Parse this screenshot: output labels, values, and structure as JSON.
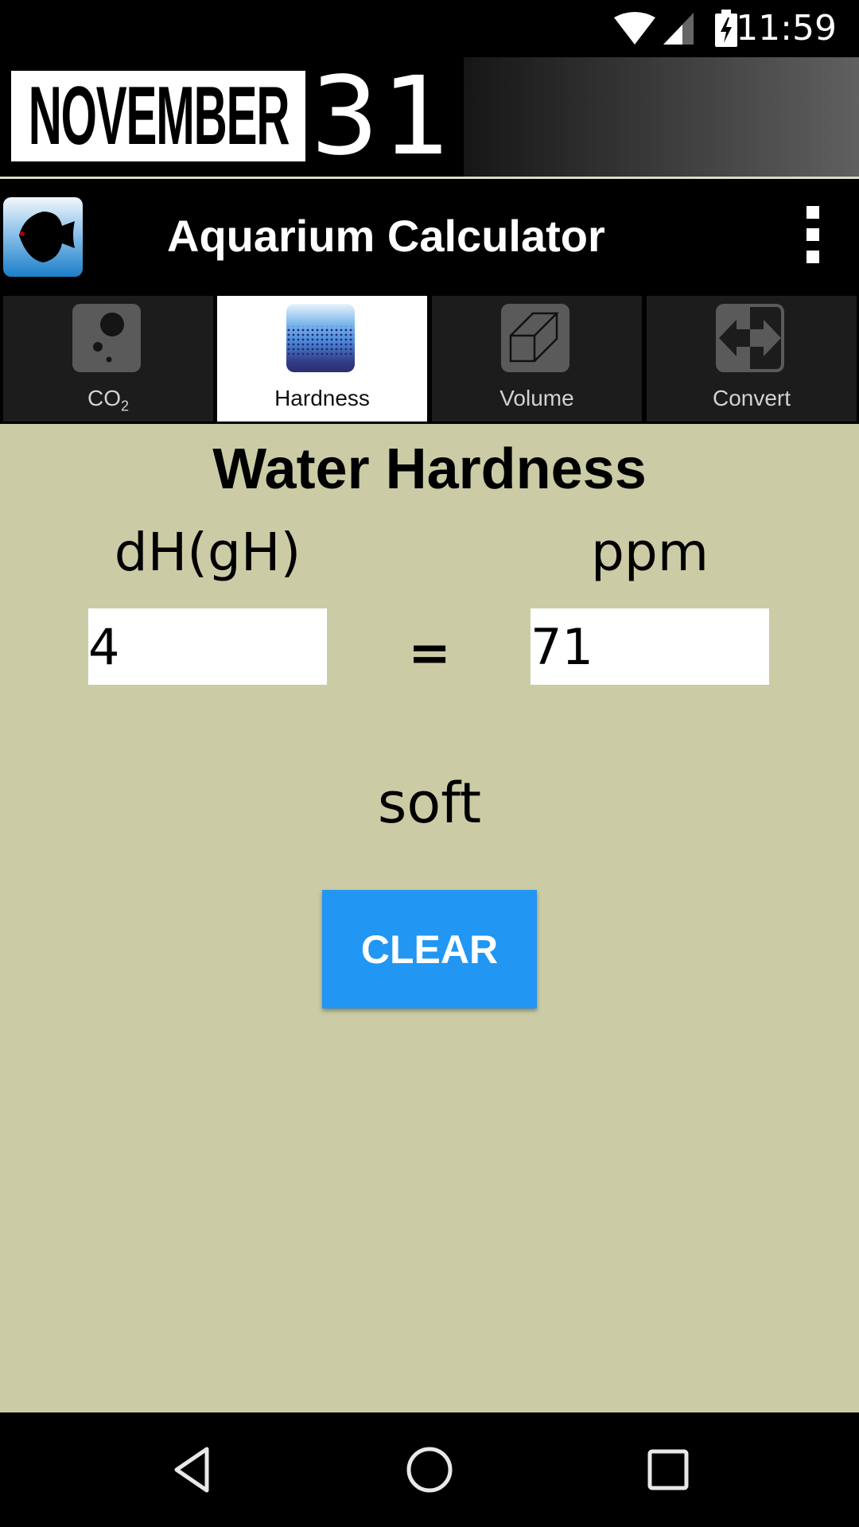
{
  "status_bar": {
    "time": "11:59",
    "icons": [
      "wifi-icon",
      "signal-icon",
      "battery-charging-icon"
    ]
  },
  "banner": {
    "logo_word": "NOVEMBER",
    "logo_number": "31"
  },
  "app_bar": {
    "title": "Aquarium Calculator",
    "icon": "fish-app-icon",
    "menu_icon": "overflow-menu-icon"
  },
  "tabs": [
    {
      "label": "CO",
      "sub": "2",
      "icon": "co2-bubbles-icon",
      "selected": false
    },
    {
      "label": "Hardness",
      "icon": "water-hardness-icon",
      "selected": true
    },
    {
      "label": "Volume",
      "icon": "cube-icon",
      "selected": false
    },
    {
      "label": "Convert",
      "icon": "convert-arrows-icon",
      "selected": false
    }
  ],
  "main": {
    "title": "Water Hardness",
    "left_label": "dH(gH)",
    "right_label": "ppm",
    "left_value": "4",
    "right_value": "71",
    "equals": "=",
    "result": "soft",
    "clear_label": "CLEAR"
  },
  "colors": {
    "background": "#cbcca5",
    "button": "#2196f3",
    "tab_selected": "#ffffff",
    "tab_unselected": "#1c1c1c"
  },
  "nav_bar": {
    "buttons": [
      "back",
      "home",
      "recents"
    ]
  }
}
